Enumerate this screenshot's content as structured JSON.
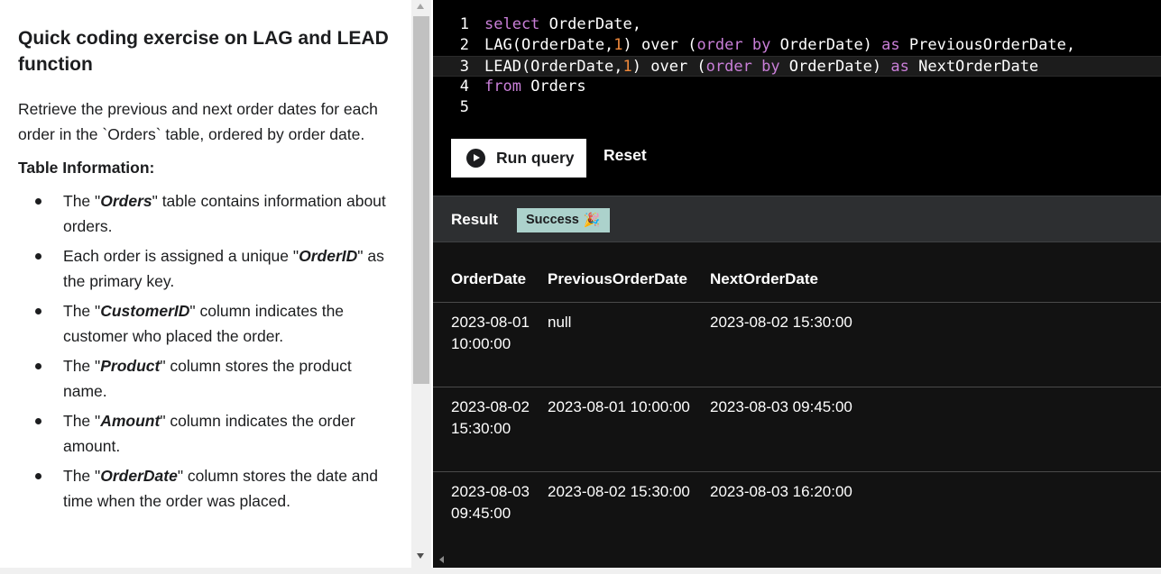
{
  "instructions": {
    "title": "Quick coding exercise on LAG and LEAD function",
    "description": "Retrieve the previous and next order dates for each order in the `Orders` table, ordered by order date.",
    "table_info_heading": "Table Information:",
    "bullets": [
      {
        "pre": "The \"",
        "em": "Orders",
        "post": "\" table contains information about orders."
      },
      {
        "pre": "Each order is assigned a unique \"",
        "em": "OrderID",
        "post": "\" as the primary key."
      },
      {
        "pre": "The \"",
        "em": "CustomerID",
        "post": "\" column indicates the customer who placed the order."
      },
      {
        "pre": "The \"",
        "em": "Product",
        "post": "\" column stores the product name."
      },
      {
        "pre": "The \"",
        "em": "Amount",
        "post": "\" column indicates the order amount."
      },
      {
        "pre": "The \"",
        "em": "OrderDate",
        "post": "\" column stores the date and time when the order was placed."
      }
    ]
  },
  "editor": {
    "line_numbers": [
      "1",
      "2",
      "3",
      "4",
      "5"
    ],
    "lines": [
      [
        {
          "t": "select",
          "k": "kw"
        },
        {
          "t": " OrderDate,",
          "k": ""
        }
      ],
      [
        {
          "t": "LAG(OrderDate,",
          "k": ""
        },
        {
          "t": "1",
          "k": "num"
        },
        {
          "t": ") over (",
          "k": ""
        },
        {
          "t": "order by",
          "k": "kw"
        },
        {
          "t": " OrderDate) ",
          "k": ""
        },
        {
          "t": "as",
          "k": "kw"
        },
        {
          "t": " PreviousOrderDate,",
          "k": ""
        }
      ],
      [
        {
          "t": "LEAD(OrderDate,",
          "k": ""
        },
        {
          "t": "1",
          "k": "num"
        },
        {
          "t": ") over (",
          "k": ""
        },
        {
          "t": "order by",
          "k": "kw"
        },
        {
          "t": " OrderDate) ",
          "k": ""
        },
        {
          "t": "as",
          "k": "kw"
        },
        {
          "t": " NextOrderDate",
          "k": ""
        }
      ],
      [
        {
          "t": "from",
          "k": "kw"
        },
        {
          "t": " Orders",
          "k": ""
        }
      ],
      []
    ],
    "active_line": 3
  },
  "actions": {
    "run_label": "Run query",
    "reset_label": "Reset"
  },
  "result": {
    "label": "Result",
    "status": "Success",
    "status_emoji": "🎉",
    "columns": [
      "OrderDate",
      "PreviousOrderDate",
      "NextOrderDate"
    ],
    "rows": [
      [
        "2023-08-01 10:00:00",
        "null",
        "2023-08-02 15:30:00"
      ],
      [
        "2023-08-02 15:30:00",
        "2023-08-01 10:00:00",
        "2023-08-03 09:45:00"
      ],
      [
        "2023-08-03 09:45:00",
        "2023-08-02 15:30:00",
        "2023-08-03 16:20:00"
      ]
    ]
  },
  "colors": {
    "keyword": "#c97fd8",
    "number": "#f0893b",
    "success_badge": "#acd2cc"
  }
}
